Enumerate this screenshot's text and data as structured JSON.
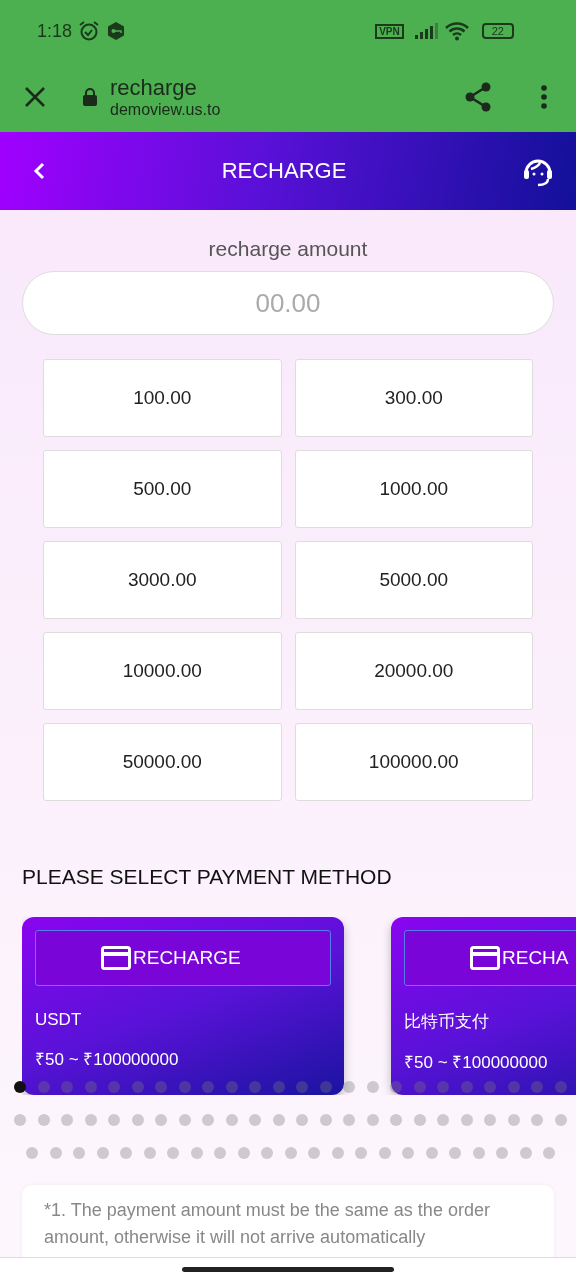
{
  "status_bar": {
    "time": "1:18",
    "vpn": "VPN",
    "battery": "22"
  },
  "browser": {
    "title": "recharge",
    "url": "demoview.us.to"
  },
  "header": {
    "title": "RECHARGE"
  },
  "amount": {
    "label": "recharge amount",
    "placeholder": "00.00"
  },
  "presets": [
    "100.00",
    "300.00",
    "500.00",
    "1000.00",
    "3000.00",
    "5000.00",
    "10000.00",
    "20000.00",
    "50000.00",
    "100000.00"
  ],
  "payment_heading": "PLEASE SELECT PAYMENT METHOD",
  "methods": [
    {
      "button": "RECHARGE",
      "name": "USDT",
      "range": "₹50 ~ ₹100000000"
    },
    {
      "button": "RECHA",
      "name": "比特币支付",
      "range": "₹50 ~ ₹100000000"
    }
  ],
  "pages": [
    {
      "selected": true
    },
    {
      "selected": false
    },
    {
      "selected": false
    },
    {
      "selected": false
    },
    {
      "selected": false
    },
    {
      "selected": false
    },
    {
      "selected": false
    },
    {
      "selected": false
    },
    {
      "selected": false
    },
    {
      "selected": false
    },
    {
      "selected": false
    },
    {
      "selected": false
    },
    {
      "selected": false
    },
    {
      "selected": false
    },
    {
      "selected": false
    },
    {
      "selected": false
    },
    {
      "selected": false
    },
    {
      "selected": false
    },
    {
      "selected": false
    },
    {
      "selected": false
    },
    {
      "selected": false
    },
    {
      "selected": false
    },
    {
      "selected": false
    },
    {
      "selected": false
    },
    {
      "selected": false
    },
    {
      "selected": false
    },
    {
      "selected": false
    },
    {
      "selected": false
    },
    {
      "selected": false
    },
    {
      "selected": false
    },
    {
      "selected": false
    },
    {
      "selected": false
    },
    {
      "selected": false
    },
    {
      "selected": false
    },
    {
      "selected": false
    },
    {
      "selected": false
    },
    {
      "selected": false
    },
    {
      "selected": false
    },
    {
      "selected": false
    },
    {
      "selected": false
    },
    {
      "selected": false
    },
    {
      "selected": false
    },
    {
      "selected": false
    },
    {
      "selected": false
    },
    {
      "selected": false
    },
    {
      "selected": false
    },
    {
      "selected": false
    },
    {
      "selected": false
    },
    {
      "selected": false
    },
    {
      "selected": false
    },
    {
      "selected": false
    },
    {
      "selected": false
    },
    {
      "selected": false
    },
    {
      "selected": false
    },
    {
      "selected": false
    },
    {
      "selected": false
    },
    {
      "selected": false
    },
    {
      "selected": false
    },
    {
      "selected": false
    },
    {
      "selected": false
    },
    {
      "selected": false
    },
    {
      "selected": false
    },
    {
      "selected": false
    },
    {
      "selected": false
    },
    {
      "selected": false
    },
    {
      "selected": false
    },
    {
      "selected": false
    },
    {
      "selected": false
    },
    {
      "selected": false
    },
    {
      "selected": false
    },
    {
      "selected": false
    }
  ],
  "notice": "*1. The payment amount must be the same as the order amount, otherwise it will not arrive automatically"
}
